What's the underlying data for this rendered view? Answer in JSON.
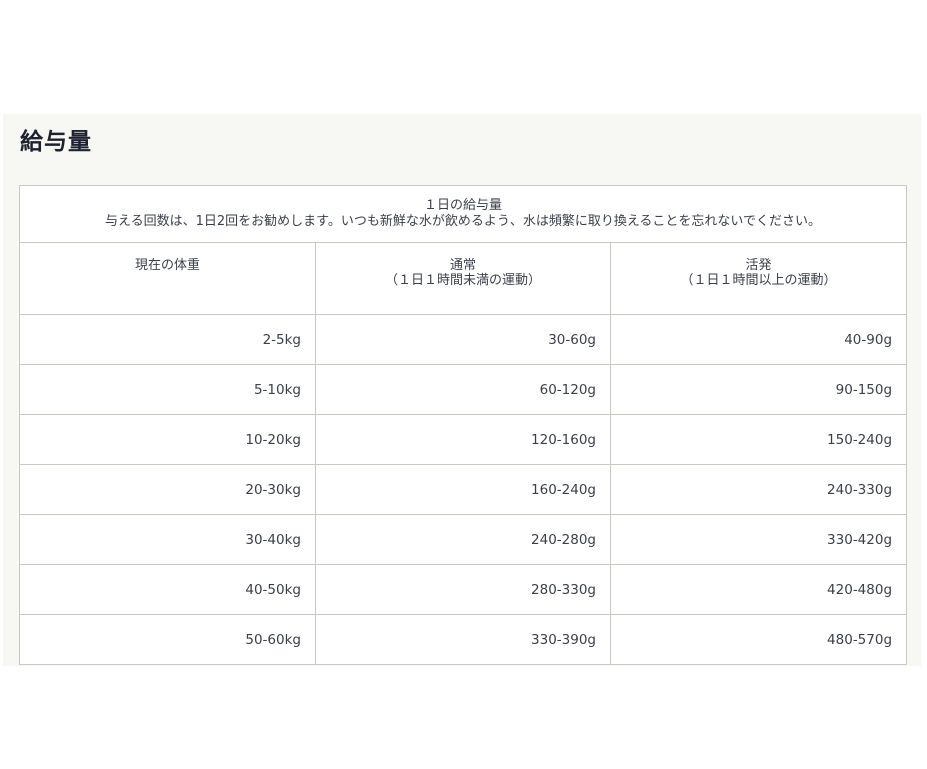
{
  "section": {
    "title": "給与量"
  },
  "table": {
    "caption": {
      "line1": "１日の給与量",
      "line2": "与える回数は、1日2回をお勧めします。いつも新鮮な水が飲めるよう、水は頻繁に取り換えることを忘れないでください。"
    },
    "headers": [
      {
        "line1": "現在の体重",
        "line2": ""
      },
      {
        "line1": "通常",
        "line2": "（１日１時間未満の運動）"
      },
      {
        "line1": "活発",
        "line2": "（１日１時間以上の運動）"
      }
    ],
    "rows": [
      [
        "2-5kg",
        "30-60g",
        "40-90g"
      ],
      [
        "5-10kg",
        "60-120g",
        "90-150g"
      ],
      [
        "10-20kg",
        "120-160g",
        "150-240g"
      ],
      [
        "20-30kg",
        "160-240g",
        "240-330g"
      ],
      [
        "30-40kg",
        "240-280g",
        "330-420g"
      ],
      [
        "40-50kg",
        "280-330g",
        "420-480g"
      ],
      [
        "50-60kg",
        "330-390g",
        "480-570g"
      ]
    ]
  }
}
